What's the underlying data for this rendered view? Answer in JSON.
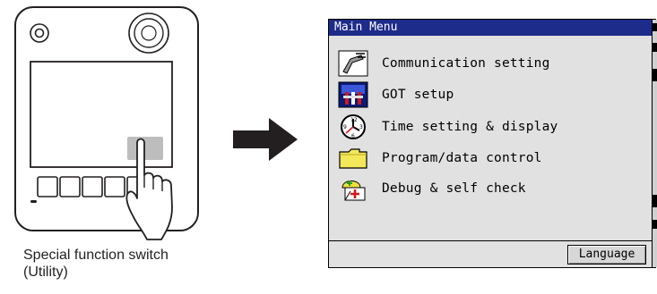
{
  "device": {
    "caption_line1": "Special function switch",
    "caption_line2": "(Utility)"
  },
  "screen": {
    "title": "Main Menu",
    "menu_items": [
      {
        "label": "Communication setting",
        "icon": "communication-icon"
      },
      {
        "label": "GOT setup",
        "icon": "got-setup-icon"
      },
      {
        "label": "Time setting & display",
        "icon": "clock-icon"
      },
      {
        "label": "Program/data control",
        "icon": "folder-icon"
      },
      {
        "label": "Debug & self check",
        "icon": "debug-icon"
      }
    ],
    "language_button": "Language"
  },
  "colors": {
    "titlebar": "#1d2b8a",
    "screen_bg": "#e1e1e1",
    "device_outline": "#231f20",
    "highlight_key": "#bdbdbd"
  }
}
